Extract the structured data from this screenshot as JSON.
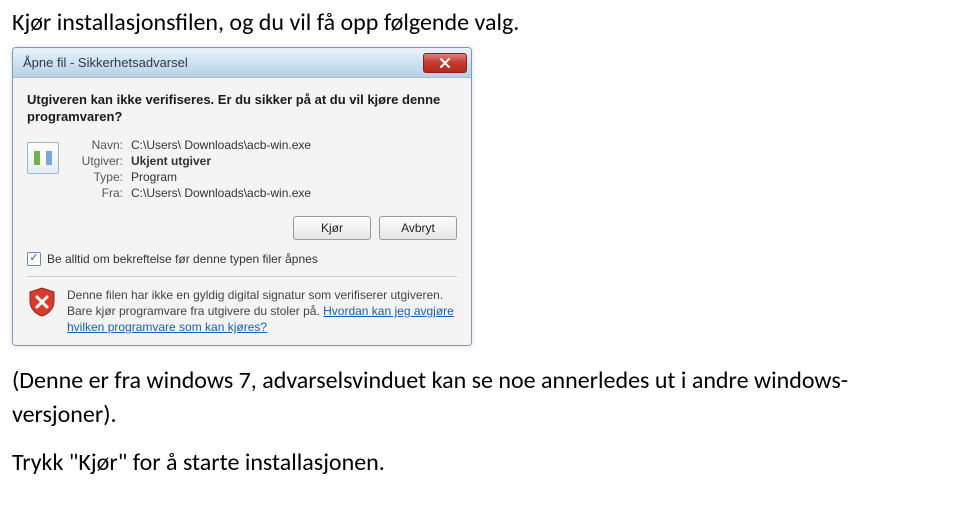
{
  "intro": "Kjør installasjonsfilen, og du vil få opp følgende valg.",
  "dialog": {
    "title": "Åpne fil - Sikkerhetsadvarsel",
    "question": "Utgiveren kan ikke verifiseres. Er du sikker på at du vil kjøre denne programvaren?",
    "fields": {
      "name_label": "Navn:",
      "name_value": "C:\\Users\\               Downloads\\acb-win.exe",
      "publisher_label": "Utgiver:",
      "publisher_value": "Ukjent utgiver",
      "type_label": "Type:",
      "type_value": "Program",
      "from_label": "Fra:",
      "from_value": "C:\\Users\\               Downloads\\acb-win.exe"
    },
    "run_button": "Kjør",
    "cancel_button": "Avbryt",
    "checkbox_label": "Be alltid om bekreftelse før denne typen filer åpnes",
    "warning_text_1": "Denne filen har ikke en gyldig digital signatur som verifiserer utgiveren. Bare kjør programvare fra utgivere du stoler på. ",
    "warning_link": "Hvordan kan jeg avgjøre hvilken programvare som kan kjøres?"
  },
  "outro_line1": "(Denne er fra windows 7, advarselsvinduet kan se noe annerledes ut i andre windows-",
  "outro_line2": "versjoner).",
  "outro_line3": "Trykk \"Kjør\" for å starte installasjonen."
}
